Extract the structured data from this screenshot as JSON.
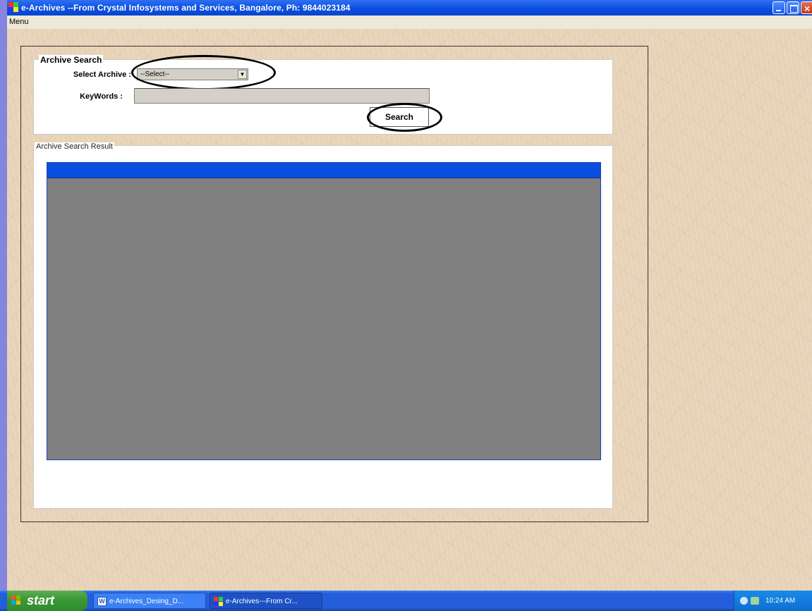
{
  "window": {
    "title": "e-Archives --From Crystal Infosystems and Services, Bangalore, Ph: 9844023184"
  },
  "menu": {
    "label": "Menu"
  },
  "archive_search": {
    "group_title": "Archive Search",
    "select_archive_label": "Select Archive :",
    "select_archive_value": "--Select--",
    "keywords_label": "KeyWords :",
    "keywords_value": "",
    "search_button": "Search"
  },
  "results": {
    "group_title": "Archive Search Result"
  },
  "taskbar": {
    "start_label": "start",
    "tasks": [
      {
        "label": "e-Archives_Desing_D..."
      },
      {
        "label": "e-Archives---From Cr..."
      }
    ],
    "clock": "10:24 AM"
  },
  "colors": {
    "titlebar": "#0a4fe0",
    "grid_header": "#0a4fe0",
    "grid_body": "#808080",
    "background": "#e8d3b8"
  },
  "icons": [
    "app-icon",
    "minimize-icon",
    "maximize-icon",
    "close-icon",
    "dropdown-arrow-icon",
    "windows-flag-icon",
    "word-doc-icon",
    "volume-icon",
    "network-icon"
  ]
}
